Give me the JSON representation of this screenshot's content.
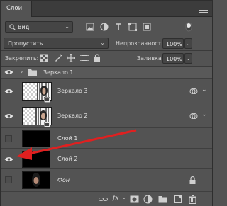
{
  "panel": {
    "tab_label": "Слои",
    "menu_icon": "hamburger-menu-icon"
  },
  "filter": {
    "kind_label": "Вид",
    "icons": [
      "image-filter-icon",
      "adjustment-filter-icon",
      "type-filter-icon",
      "shape-filter-icon",
      "smart-object-filter-icon"
    ]
  },
  "blend": {
    "mode_value": "Пропустить",
    "opacity_label": "Непрозрачность:",
    "opacity_value": "100%"
  },
  "lock": {
    "label": "Закрепить:",
    "fill_label": "Заливка:",
    "fill_value": "100%",
    "icons": [
      "lock-transparency-icon",
      "lock-pixels-icon",
      "lock-position-icon",
      "lock-artboard-icon",
      "lock-all-icon"
    ]
  },
  "layers": [
    {
      "name": "Зеркало 1",
      "visible": true,
      "kind": "group"
    },
    {
      "name": "Зеркало 3",
      "visible": true,
      "kind": "smart",
      "has_link_icon": true
    },
    {
      "name": "Зеркало 2",
      "visible": true,
      "kind": "smart",
      "has_link_icon": true
    },
    {
      "name": "Слой 1",
      "visible": false,
      "kind": "layer"
    },
    {
      "name": "Слой 2",
      "visible": true,
      "kind": "layer"
    },
    {
      "name": "Фон",
      "visible": false,
      "kind": "background",
      "locked": true
    }
  ],
  "bottom_toolbar": [
    "link-layers-icon",
    "fx-icon",
    "add-mask-icon",
    "adjustment-layer-icon",
    "new-group-icon",
    "new-layer-icon",
    "delete-layer-icon"
  ],
  "bottom_fx_label": "fx",
  "annotation": {
    "arrow_color": "#e02020"
  }
}
